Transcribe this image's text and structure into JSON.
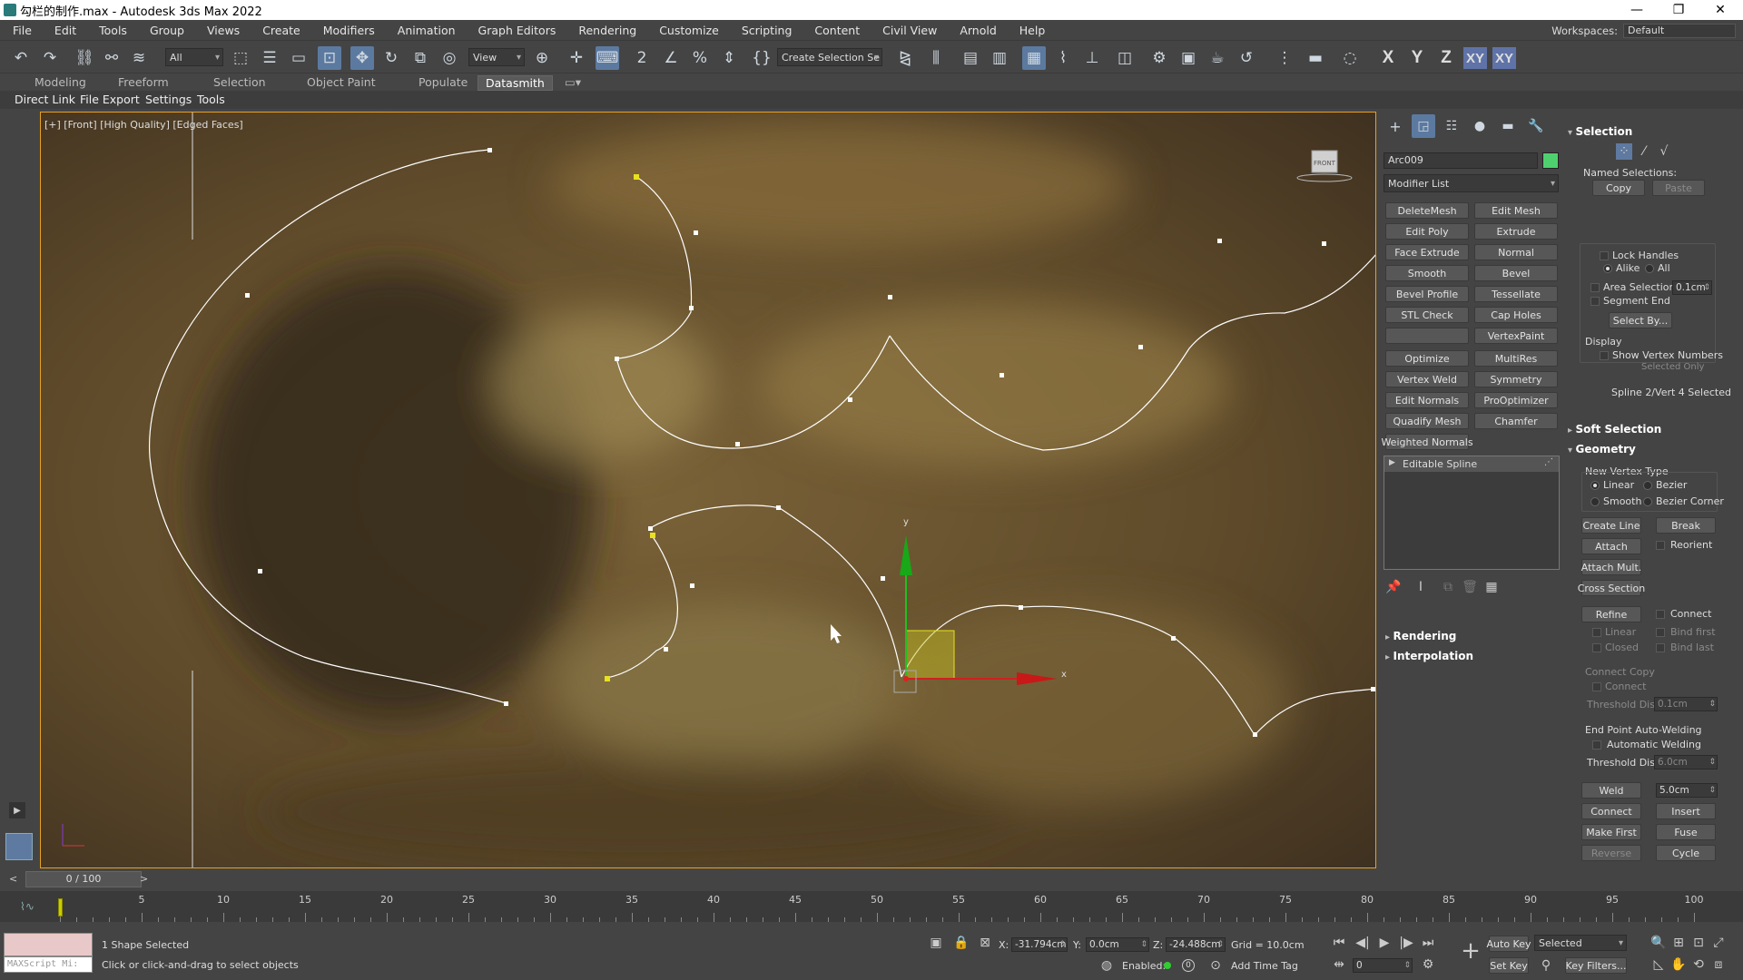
{
  "window": {
    "title": "勾栏的制作.max - Autodesk 3ds Max 2022"
  },
  "menu": [
    "File",
    "Edit",
    "Tools",
    "Group",
    "Views",
    "Create",
    "Modifiers",
    "Animation",
    "Graph Editors",
    "Rendering",
    "Customize",
    "Scripting",
    "Content",
    "Civil View",
    "Arnold",
    "Help"
  ],
  "workspaces": {
    "label": "Workspaces:",
    "value": "Default"
  },
  "toolbar": {
    "filter": "All",
    "ref_coord": "View",
    "selection_set": "Create Selection Se",
    "axes": [
      "X",
      "Y",
      "Z",
      "XY",
      "XY"
    ]
  },
  "ribbon_tabs": [
    "Modeling",
    "Freeform",
    "Selection",
    "Object Paint",
    "Populate",
    "Datasmith"
  ],
  "sub_tabs": [
    "Direct Link",
    "File Export",
    "Settings",
    "Tools"
  ],
  "viewport": {
    "label": "[+] [Front] [High Quality] [Edged Faces]",
    "viewcube": "FRONT",
    "gizmo_y": "y",
    "gizmo_x": "x"
  },
  "command_panel": {
    "object_name": "Arc009",
    "object_color": "#4fd06f",
    "modifier_list": "Modifier List",
    "buttons": [
      [
        "DeleteMesh",
        "Edit Mesh"
      ],
      [
        "Edit Poly",
        "Extrude"
      ],
      [
        "Face Extrude",
        "Normal"
      ],
      [
        "Smooth",
        "Bevel"
      ],
      [
        "Bevel Profile",
        "Tessellate"
      ],
      [
        "STL Check",
        "Cap Holes"
      ],
      [
        "",
        "VertexPaint"
      ],
      [
        "Optimize",
        "MultiRes"
      ],
      [
        "Vertex Weld",
        "Symmetry"
      ],
      [
        "Edit Normals",
        "ProOptimizer"
      ],
      [
        "Quadify Mesh",
        "Chamfer"
      ],
      [
        "Weighted Normals",
        ""
      ]
    ],
    "stack_item": "Editable Spline",
    "rollouts": [
      "Rendering",
      "Interpolation"
    ]
  },
  "selection_rollout": {
    "title": "Selection",
    "named_selections": "Named Selections:",
    "copy": "Copy",
    "paste": "Paste",
    "lock_handles": "Lock Handles",
    "alike": "Alike",
    "all": "All",
    "area_selection": "Area Selection",
    "area_value": "0.1cm",
    "segment_end": "Segment End",
    "select_by": "Select By...",
    "display": "Display",
    "show_vertex_numbers": "Show Vertex Numbers",
    "selected_only": "Selected Only",
    "status": "Spline 2/Vert 4 Selected"
  },
  "soft_selection": "Soft Selection",
  "geometry": {
    "title": "Geometry",
    "new_vertex_type": "New Vertex Type",
    "linear": "Linear",
    "bezier": "Bezier",
    "smooth": "Smooth",
    "bezier_corner": "Bezier Corner",
    "create_line": "Create Line",
    "break": "Break",
    "attach": "Attach",
    "reorient": "Reorient",
    "attach_mult": "Attach Mult.",
    "cross_section": "Cross Section",
    "refine": "Refine",
    "connect": "Connect",
    "linear2": "Linear",
    "bind_first": "Bind first",
    "closed": "Closed",
    "bind_last": "Bind last",
    "connect_copy": "Connect Copy",
    "connect2": "Connect",
    "threshold_dist": "Threshold Dist",
    "threshold_value": "0.1cm",
    "end_point_auto_welding": "End Point Auto-Welding",
    "automatic_welding": "Automatic Welding",
    "threshold_dist2": "Threshold Dist",
    "threshold_value2": "6.0cm",
    "weld": "Weld",
    "weld_value": "5.0cm",
    "connect3": "Connect",
    "insert": "Insert",
    "make_first": "Make First",
    "fuse": "Fuse",
    "reverse": "Reverse",
    "cycle": "Cycle"
  },
  "timeslider": {
    "frame": "0 / 100"
  },
  "trackbar": {
    "ticks": [
      "5",
      "10",
      "15",
      "20",
      "25",
      "30",
      "35",
      "40",
      "45",
      "50",
      "55",
      "60",
      "65",
      "70",
      "75",
      "80",
      "85",
      "90",
      "95",
      "100"
    ]
  },
  "status": {
    "maxscript": "MAXScript Mi:",
    "selected": "1 Shape Selected",
    "prompt": "Click or click-and-drag to select objects",
    "x_label": "X:",
    "x": "-31.794cm",
    "y_label": "Y:",
    "y": "0.0cm",
    "z_label": "Z:",
    "z": "-24.488cm",
    "grid": "Grid = 10.0cm",
    "enabled": "Enabled:",
    "add_time_tag": "Add Time Tag",
    "frame_value": "0",
    "auto_key": "Auto Key",
    "set_key": "Set Key",
    "key_mode": "Selected",
    "key_filters": "Key Filters..."
  }
}
